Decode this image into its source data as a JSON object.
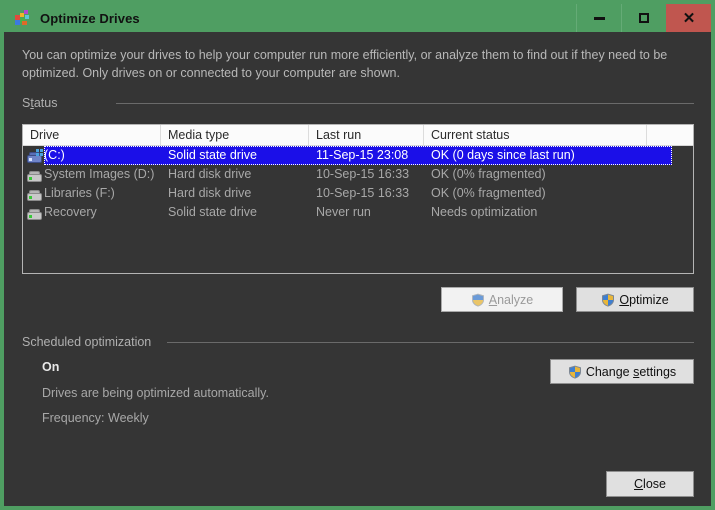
{
  "window": {
    "title": "Optimize Drives",
    "app_icon": "defrag-icon",
    "accent_color": "#4f9e62",
    "close_color": "#c0564f",
    "background": "#353535"
  },
  "caption": {
    "minimize": "minimize-icon",
    "maximize": "maximize-icon",
    "close": "✕"
  },
  "description": "You can optimize your drives to help your computer run more efficiently, or analyze them to find out if they need to be optimized. Only drives on or connected to your computer are shown.",
  "status_group": {
    "label_pre": "S",
    "label_accel": "t",
    "label_post": "atus",
    "columns": [
      "Drive",
      "Media type",
      "Last run",
      "Current status"
    ],
    "rows": [
      {
        "icon": "system-drive-icon",
        "drive": "(C:)",
        "media_type": "Solid state drive",
        "last_run": "11-Sep-15 23:08",
        "current_status": "OK (0 days since last run)",
        "selected": true
      },
      {
        "icon": "hard-drive-icon",
        "drive": "System Images (D:)",
        "media_type": "Hard disk drive",
        "last_run": "10-Sep-15 16:33",
        "current_status": "OK (0% fragmented)",
        "selected": false
      },
      {
        "icon": "hard-drive-icon",
        "drive": "Libraries (F:)",
        "media_type": "Hard disk drive",
        "last_run": "10-Sep-15 16:33",
        "current_status": "OK (0% fragmented)",
        "selected": false
      },
      {
        "icon": "hard-drive-icon",
        "drive": "Recovery",
        "media_type": "Solid state drive",
        "last_run": "Never run",
        "current_status": "Needs optimization",
        "selected": false
      }
    ]
  },
  "buttons": {
    "analyze": {
      "pre": "",
      "accel": "A",
      "post": "nalyze",
      "enabled": false,
      "shield": true
    },
    "optimize": {
      "pre": "",
      "accel": "O",
      "post": "ptimize",
      "enabled": true,
      "shield": true
    },
    "change_settings": {
      "pre": "Change ",
      "accel": "s",
      "post": "ettings",
      "enabled": true,
      "shield": true
    },
    "close": {
      "pre": "",
      "accel": "C",
      "post": "lose",
      "enabled": true,
      "shield": false
    }
  },
  "scheduled_group": {
    "label": "Scheduled optimization",
    "state": "On",
    "detail": "Drives are being optimized automatically.",
    "frequency": "Frequency: Weekly"
  }
}
